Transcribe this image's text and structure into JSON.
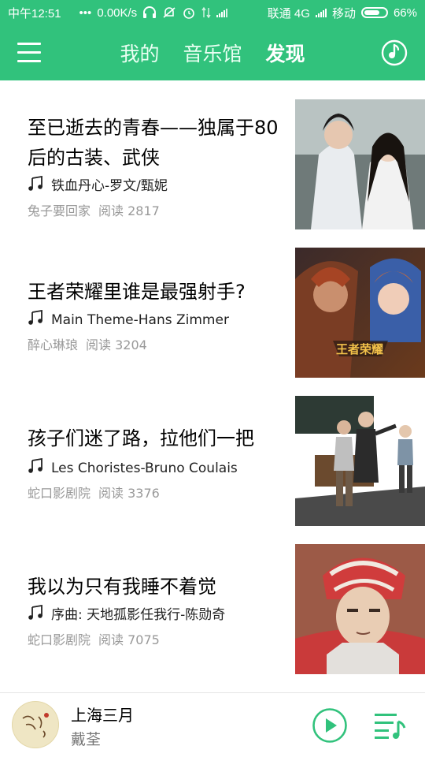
{
  "status_bar": {
    "time": "中午12:51",
    "dots": "•••",
    "speed": "0.00K/s",
    "carrier1": "联通 4G",
    "carrier2": "移动",
    "battery": "66%"
  },
  "nav": {
    "tabs": [
      {
        "label": "我的",
        "active": false
      },
      {
        "label": "音乐馆",
        "active": false
      },
      {
        "label": "发现",
        "active": true
      }
    ]
  },
  "feed": {
    "items": [
      {
        "title": "至已逝去的青春——独属于80后的古装、武侠",
        "song": "铁血丹心-罗文/甄妮",
        "author": "兔子要回家",
        "reads": "阅读  2817"
      },
      {
        "title": "王者荣耀里谁是最强射手?",
        "song": "Main Theme-Hans Zimmer",
        "author": "醉心琳琅",
        "reads": "阅读  3204",
        "thumb_logo": "王者荣耀"
      },
      {
        "title": "孩子们迷了路，拉他们一把",
        "song": "Les Choristes-Bruno Coulais",
        "author": "蛇口影剧院",
        "reads": "阅读  3376"
      },
      {
        "title": "我以为只有我睡不着觉",
        "song": "序曲: 天地孤影任我行-陈勋奇",
        "author": "蛇口影剧院",
        "reads": "阅读  7075"
      }
    ]
  },
  "player": {
    "song_title": "上海三月",
    "artist": "戴荃"
  },
  "colors": {
    "brand_green": "#31c27c",
    "text_primary": "#000000",
    "text_secondary": "#999999"
  },
  "icons": {
    "menu": "menu-icon",
    "radar": "recognize-music-icon",
    "note": "music-note-icon",
    "play": "play-icon",
    "playlist": "playlist-icon"
  }
}
